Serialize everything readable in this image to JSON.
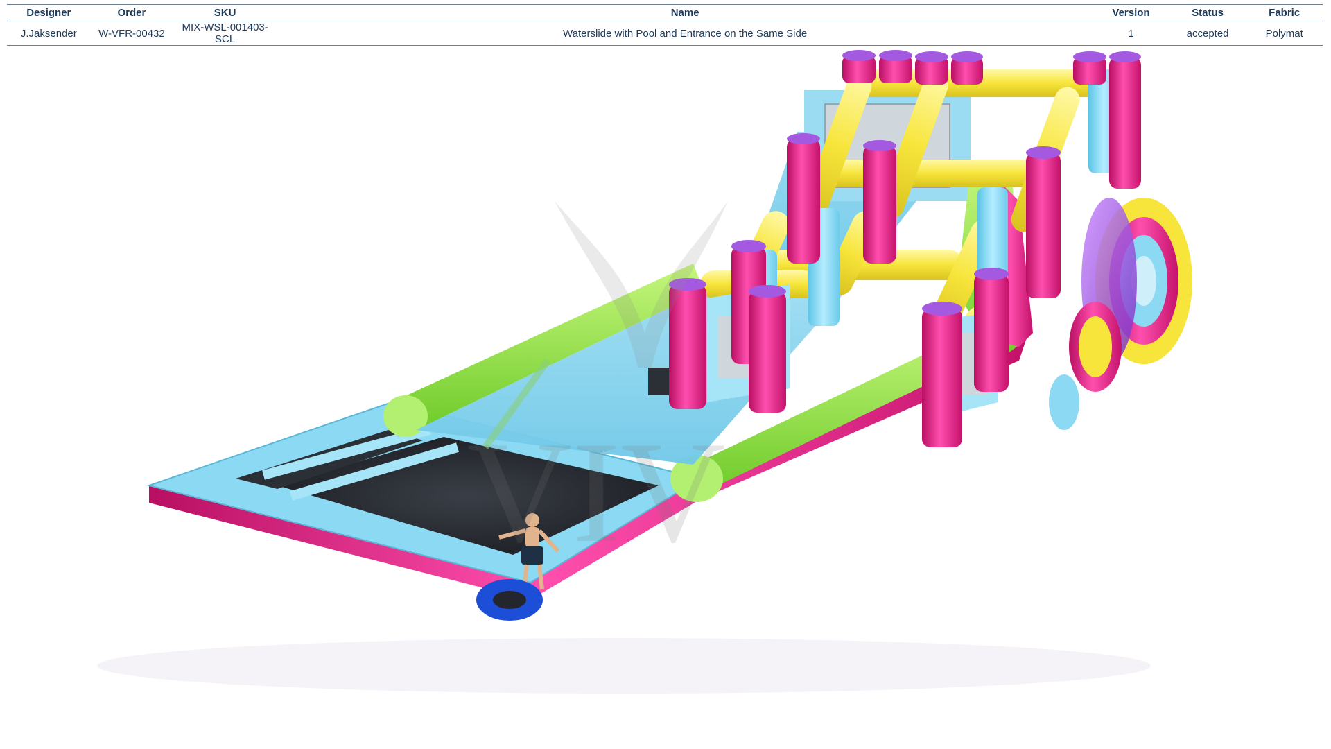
{
  "header": {
    "designer_label": "Designer",
    "order_label": "Order",
    "sku_label": "SKU",
    "name_label": "Name",
    "version_label": "Version",
    "status_label": "Status",
    "fabric_label": "Fabric"
  },
  "record": {
    "designer": "J.Jaksender",
    "order": "W-VFR-00432",
    "sku": "MIX-WSL-001403-SCL",
    "name": "Waterslide with Pool and Entrance on the Same Side",
    "version": "1",
    "status": "accepted",
    "fabric": "Polymat"
  },
  "render": {
    "watermark_text": "VIV",
    "colors": {
      "pink": "#e8157f",
      "yellow": "#f7e53b",
      "green": "#8ee23c",
      "blue": "#7fd6f2",
      "purple": "#8a3fd1",
      "tube": "#1d4ed8",
      "water": "#23262c"
    }
  }
}
